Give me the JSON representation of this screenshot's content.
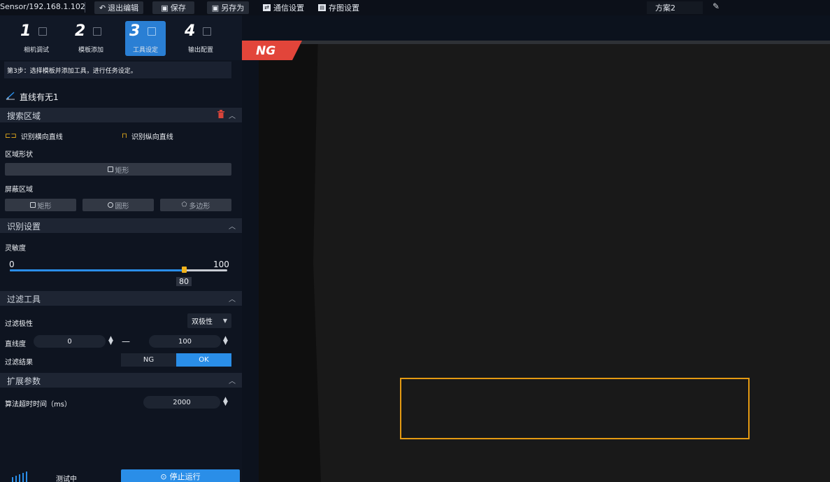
{
  "topbar": {
    "path": "Sensor/192.168.1.102",
    "exit_edit": "退出编辑",
    "save": "保存",
    "save_as": "另存为",
    "comm_settings": "通信设置",
    "image_save_settings": "存图设置",
    "scheme": "方案2"
  },
  "steps": [
    {
      "num": "1",
      "label": "相机调试"
    },
    {
      "num": "2",
      "label": "模板添加"
    },
    {
      "num": "3",
      "label": "工具设定"
    },
    {
      "num": "4",
      "label": "输出配置"
    }
  ],
  "tip": "第3步：选择模板并添加工具，进行任务设定。",
  "tool_title": "直线有无1",
  "search_area": {
    "header": "搜索区域",
    "horizontal": "识别横向直线",
    "vertical": "识别纵向直线",
    "region_shape_label": "区域形状",
    "region_shape_value": "矩形",
    "mask_label": "屏蔽区域",
    "mask_rect": "矩形",
    "mask_circle": "圆形",
    "mask_polygon": "多边形"
  },
  "recognition": {
    "header": "识别设置",
    "sensitivity_label": "灵敏度",
    "min": "0",
    "max": "100",
    "value": "80",
    "value_fraction": 0.8
  },
  "filter": {
    "header": "过滤工具",
    "polarity_label": "过滤极性",
    "polarity_value": "双极性",
    "linearity_label": "直线度",
    "linearity_min": "0",
    "linearity_dash": "—",
    "linearity_max": "100",
    "result_label": "过滤结果",
    "result_ng": "NG",
    "result_ok": "OK"
  },
  "extended": {
    "header": "扩展参数",
    "timeout_label": "算法超时时间（ms）",
    "timeout_value": "2000"
  },
  "status": {
    "testing": "测试中",
    "stop_button": "停止运行"
  },
  "viewer": {
    "result_badge": "NG"
  },
  "colors": {
    "accent": "#2a8ee8",
    "ng_badge": "#e2453a",
    "roi": "#e49a12",
    "trash": "#d9453b"
  }
}
